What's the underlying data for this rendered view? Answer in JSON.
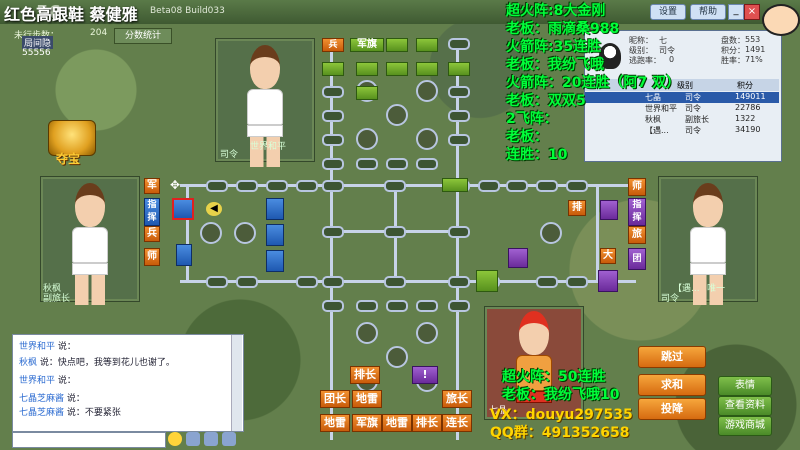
{
  "window": {
    "title_overlay": "红色高跟鞋  蔡健雅",
    "title_version": "Beta08 Build033",
    "brand_mark": "56",
    "step_label": "未行步数：",
    "step_count": "204",
    "score_tab": "分数统计",
    "hidden_label": "局间隐",
    "room_number": "55556",
    "top_buttons": [
      "设置",
      "帮助"
    ]
  },
  "treasure": {
    "label": "夺宝"
  },
  "players": {
    "top": {
      "name": "世界和平",
      "rank": "司令"
    },
    "left": {
      "name": "秋枫",
      "rank": "副旅长"
    },
    "right": {
      "name": "【遇...",
      "rank": "司令",
      "extra": "唯一"
    },
    "bottom": {
      "name": "七晶",
      "rank": "司令"
    }
  },
  "info_panel": {
    "nick_label": "昵称：",
    "nick_value": "七",
    "level_label": "级别：",
    "level_value": "司令",
    "win_label": "胜率：",
    "win_value": "71%",
    "escape_label": "逃跑率：",
    "escape_value": "0",
    "games_label": "盘数：",
    "games_value": "553",
    "score_label": "积分：",
    "score_value": "1491",
    "columns": [
      "",
      "级别",
      "积分"
    ],
    "rows": [
      {
        "name": "七晶",
        "rank": "司令",
        "score": "149011"
      },
      {
        "name": "世界和平",
        "rank": "司令",
        "score": "22786"
      },
      {
        "name": "秋枫",
        "rank": "副旅长",
        "score": "1322"
      },
      {
        "name": "【遇...",
        "rank": "司令",
        "score": "34190"
      }
    ]
  },
  "overlay_text": [
    "超火阵:8大金刚",
    "老板：雨滴桑988",
    "火箭阵:35连胜",
    "老板：我纷飞哦",
    "火箭阵：20连胜（阿7 双）",
    "老板：双双5",
    "2飞阵：",
    "老板：",
    "连胜：10"
  ],
  "overlay_bottom": {
    "line1": "超火阵：50连胜",
    "line2": "老板：我纷飞哦10",
    "vx": "VX：douyu297535",
    "qq": "QQ群：491352658"
  },
  "board": {
    "top_pieces": [
      "兵",
      "军旗"
    ],
    "left_pieces": [
      "军",
      "指挥",
      "兵",
      "师"
    ],
    "right_pieces": [
      "师",
      "指挥",
      "旅",
      "团"
    ],
    "center_pieces": [
      "排",
      "大"
    ],
    "bottom_pieces_row1": [
      "排长",
      "!"
    ],
    "bottom_pieces_row2": [
      "团长",
      "地雷",
      "旅长"
    ],
    "bottom_pieces_row3": [
      "地雷",
      "军旗",
      "地雷",
      "排长",
      "连长"
    ]
  },
  "chat": {
    "lines": [
      {
        "name": "世界和平",
        "text": "说："
      },
      {
        "name": "秋枫",
        "text": "说：快点吧，我等到花儿也谢了。"
      },
      {
        "name": "世界和平",
        "text": "说："
      },
      {
        "name": "七晶芝麻酱",
        "text": "说："
      },
      {
        "name": "七晶芝麻酱",
        "text": "说：不要紧张"
      }
    ]
  },
  "action_buttons": [
    "跳过",
    "求和",
    "投降"
  ],
  "side_buttons": [
    "表情",
    "查看资料",
    "游戏商城"
  ]
}
